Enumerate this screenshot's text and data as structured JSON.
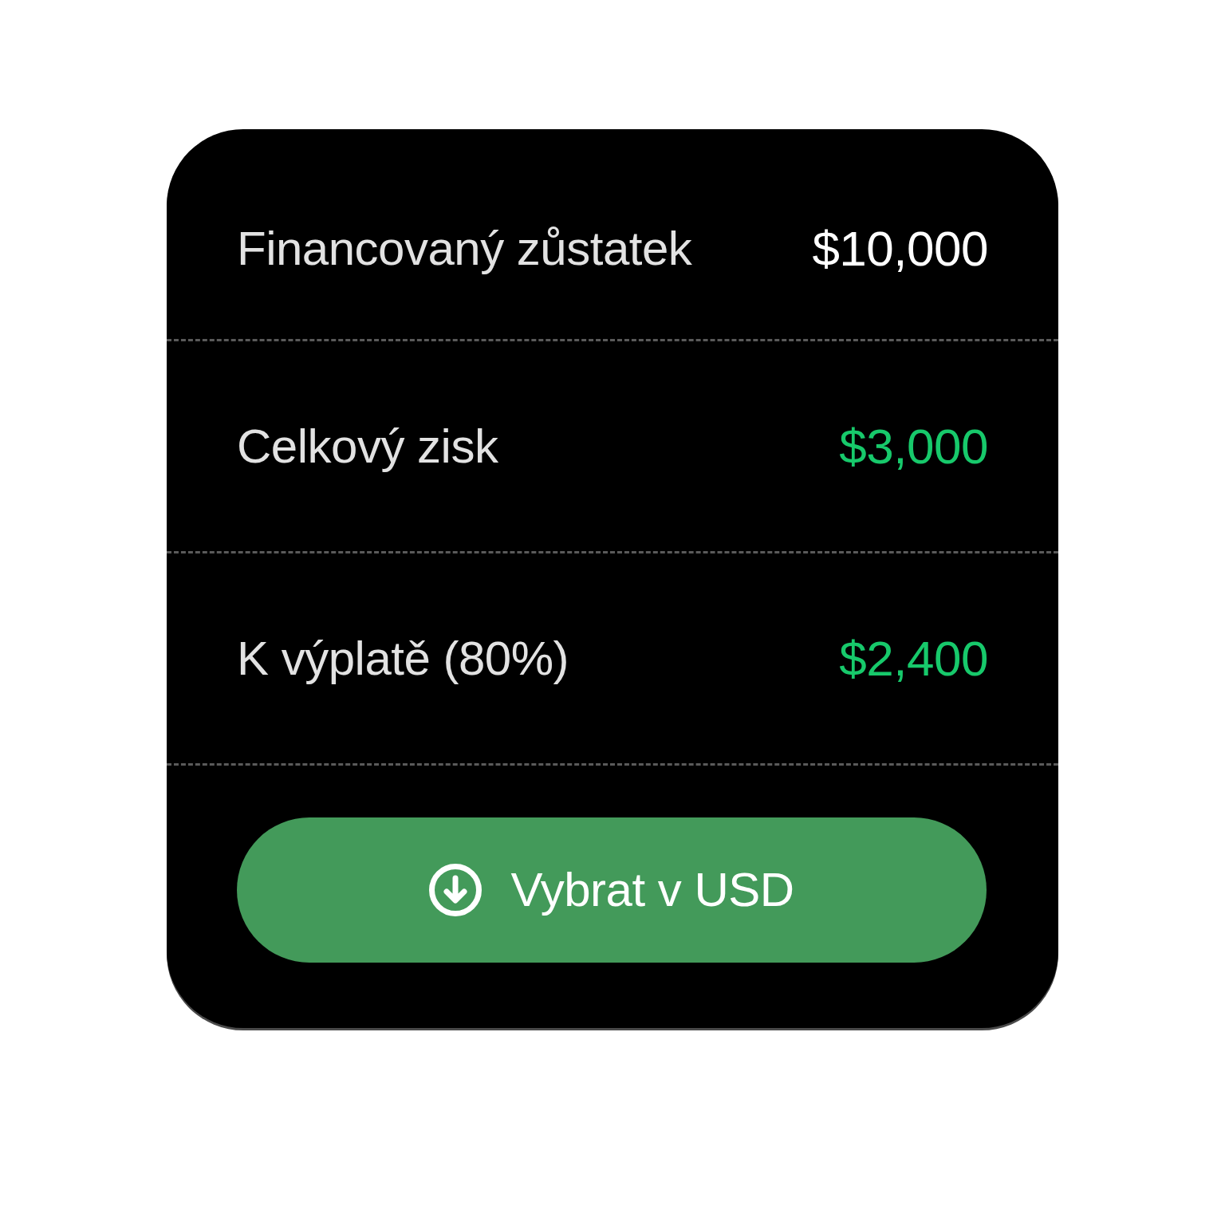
{
  "rows": [
    {
      "label": "Financovaný zůstatek",
      "value": "$10,000",
      "color": "#ffffff"
    },
    {
      "label": "Celkový zisk",
      "value": "$3,000",
      "color": "#17c96b"
    },
    {
      "label": "K výplatě (80%)",
      "value": "$2,400",
      "color": "#17c96b"
    }
  ],
  "button": {
    "label": "Vybrat v USD"
  }
}
